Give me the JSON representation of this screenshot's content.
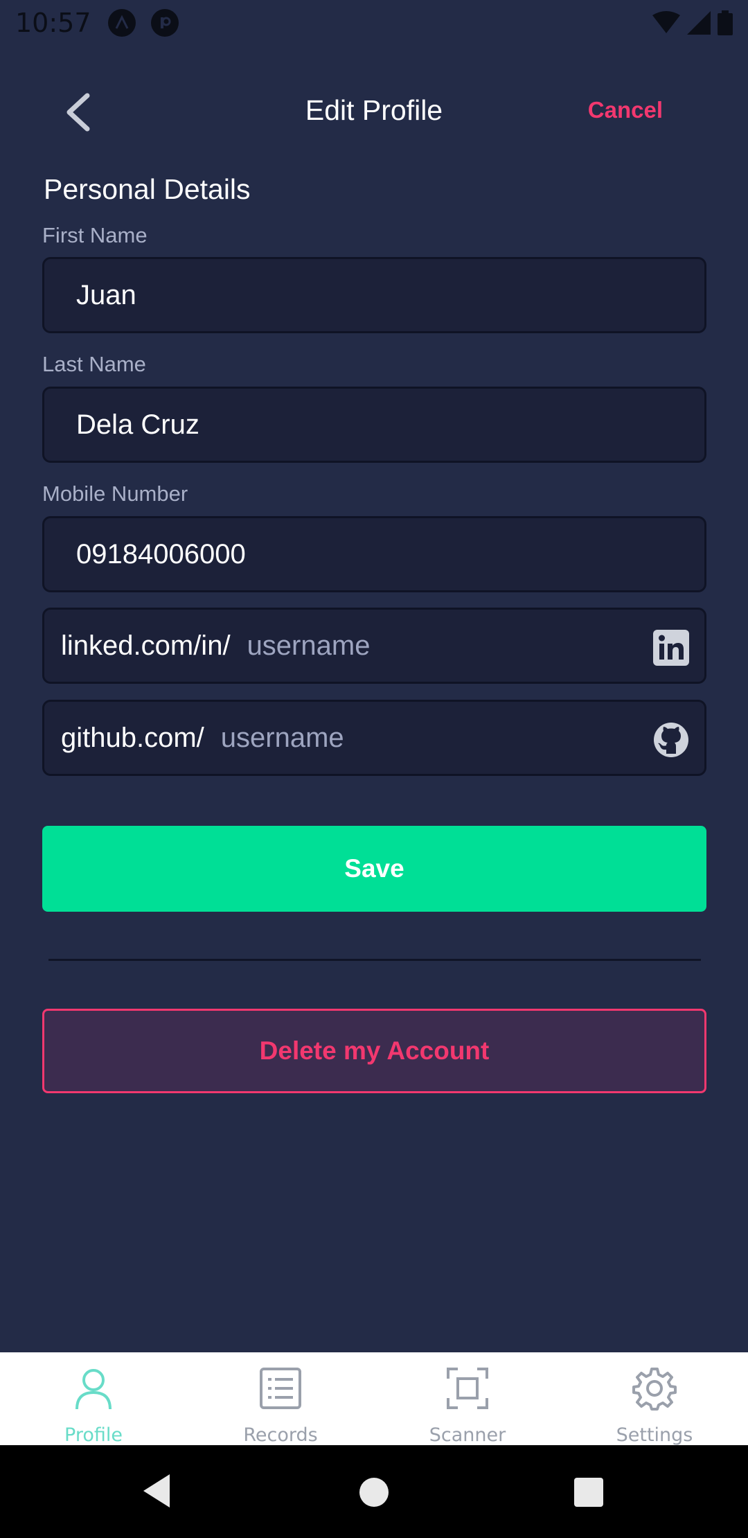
{
  "status_bar": {
    "time": "10:57",
    "icons": [
      "app-a-icon",
      "app-p-icon",
      "wifi-icon",
      "signal-icon",
      "battery-icon"
    ]
  },
  "header": {
    "title": "Edit Profile",
    "cancel_label": "Cancel"
  },
  "form": {
    "section_title": "Personal Details",
    "first_name": {
      "label": "First Name",
      "value": "Juan"
    },
    "last_name": {
      "label": "Last Name",
      "value": "Dela Cruz"
    },
    "mobile": {
      "label": "Mobile Number",
      "value": "09184006000"
    },
    "linkedin": {
      "prefix": "linked.com/in/",
      "placeholder": "username",
      "icon": "linkedin-icon"
    },
    "github": {
      "prefix": "github.com/",
      "placeholder": "username",
      "icon": "github-icon"
    }
  },
  "actions": {
    "save_label": "Save",
    "delete_label": "Delete my Account"
  },
  "tabs": [
    {
      "label": "Profile",
      "icon": "person-icon",
      "active": true
    },
    {
      "label": "Records",
      "icon": "list-icon",
      "active": false
    },
    {
      "label": "Scanner",
      "icon": "scan-icon",
      "active": false
    },
    {
      "label": "Settings",
      "icon": "gear-icon",
      "active": false
    }
  ],
  "colors": {
    "background": "#232b47",
    "input_bg": "#1c2139",
    "accent_pink": "#f2386f",
    "accent_green": "#00df96",
    "tab_active": "#68dcc8"
  }
}
